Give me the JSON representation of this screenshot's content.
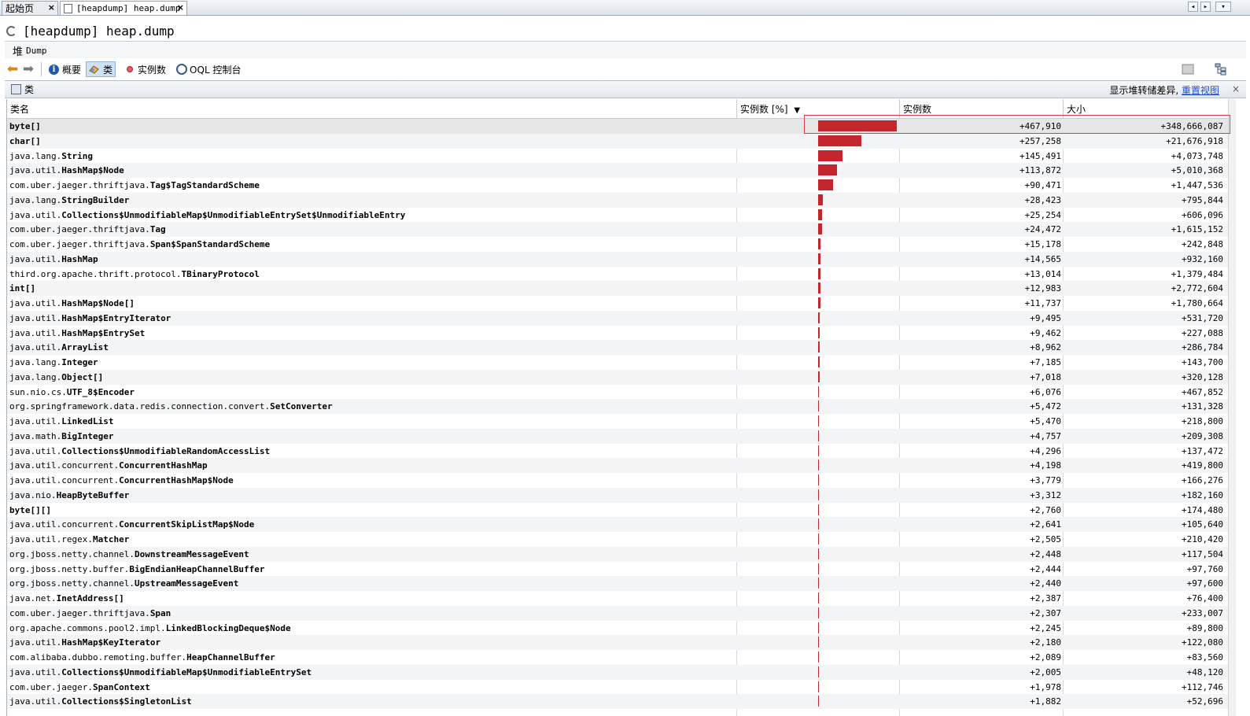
{
  "tabs": [
    {
      "label": "起始页",
      "close": "×"
    },
    {
      "label": "[heapdump] heap.dump",
      "close": "×"
    }
  ],
  "title": "[heapdump] heap.dump",
  "heap_bar": {
    "zh": "堆",
    "label": "Dump"
  },
  "toolbar": {
    "overview": "概要",
    "classes": "类",
    "instances": "实例数",
    "oql": "OQL 控制台"
  },
  "panel": {
    "title": "类",
    "diff_text": "显示堆转储差异,",
    "reset_link": "重置视图",
    "close": "×"
  },
  "columns": {
    "name": "类名",
    "percent": "实例数 [%]",
    "count": "实例数",
    "size": "大小"
  },
  "rows": [
    {
      "pkg": "",
      "cls": "byte[]",
      "count": "+467,910",
      "size": "+348,666,087",
      "pct": 100
    },
    {
      "pkg": "",
      "cls": "char[]",
      "count": "+257,258",
      "size": "+21,676,918",
      "pct": 55
    },
    {
      "pkg": "java.lang.",
      "cls": "String",
      "count": "+145,491",
      "size": "+4,073,748",
      "pct": 31
    },
    {
      "pkg": "java.util.",
      "cls": "HashMap$Node",
      "count": "+113,872",
      "size": "+5,010,368",
      "pct": 24
    },
    {
      "pkg": "com.uber.jaeger.thriftjava.",
      "cls": "Tag$TagStandardScheme",
      "count": "+90,471",
      "size": "+1,447,536",
      "pct": 19
    },
    {
      "pkg": "java.lang.",
      "cls": "StringBuilder",
      "count": "+28,423",
      "size": "+795,844",
      "pct": 6
    },
    {
      "pkg": "java.util.",
      "cls": "Collections$UnmodifiableMap$UnmodifiableEntrySet$UnmodifiableEntry",
      "count": "+25,254",
      "size": "+606,096",
      "pct": 5.4
    },
    {
      "pkg": "com.uber.jaeger.thriftjava.",
      "cls": "Tag",
      "count": "+24,472",
      "size": "+1,615,152",
      "pct": 5.2
    },
    {
      "pkg": "com.uber.jaeger.thriftjava.",
      "cls": "Span$SpanStandardScheme",
      "count": "+15,178",
      "size": "+242,848",
      "pct": 3.2
    },
    {
      "pkg": "java.util.",
      "cls": "HashMap",
      "count": "+14,565",
      "size": "+932,160",
      "pct": 3.1
    },
    {
      "pkg": "third.org.apache.thrift.protocol.",
      "cls": "TBinaryProtocol",
      "count": "+13,014",
      "size": "+1,379,484",
      "pct": 2.8
    },
    {
      "pkg": "",
      "cls": "int[]",
      "count": "+12,983",
      "size": "+2,772,604",
      "pct": 2.8
    },
    {
      "pkg": "java.util.",
      "cls": "HashMap$Node[]",
      "count": "+11,737",
      "size": "+1,780,664",
      "pct": 2.5
    },
    {
      "pkg": "java.util.",
      "cls": "HashMap$EntryIterator",
      "count": "+9,495",
      "size": "+531,720",
      "pct": 2.0
    },
    {
      "pkg": "java.util.",
      "cls": "HashMap$EntrySet",
      "count": "+9,462",
      "size": "+227,088",
      "pct": 2.0
    },
    {
      "pkg": "java.util.",
      "cls": "ArrayList",
      "count": "+8,962",
      "size": "+286,784",
      "pct": 1.9
    },
    {
      "pkg": "java.lang.",
      "cls": "Integer",
      "count": "+7,185",
      "size": "+143,700",
      "pct": 1.5
    },
    {
      "pkg": "java.lang.",
      "cls": "Object[]",
      "count": "+7,018",
      "size": "+320,128",
      "pct": 1.5
    },
    {
      "pkg": "sun.nio.cs.",
      "cls": "UTF_8$Encoder",
      "count": "+6,076",
      "size": "+467,852",
      "pct": 1.3
    },
    {
      "pkg": "org.springframework.data.redis.connection.convert.",
      "cls": "SetConverter",
      "count": "+5,472",
      "size": "+131,328",
      "pct": 1.2
    },
    {
      "pkg": "java.util.",
      "cls": "LinkedList",
      "count": "+5,470",
      "size": "+218,800",
      "pct": 1.2
    },
    {
      "pkg": "java.math.",
      "cls": "BigInteger",
      "count": "+4,757",
      "size": "+209,308",
      "pct": 1.0
    },
    {
      "pkg": "java.util.",
      "cls": "Collections$UnmodifiableRandomAccessList",
      "count": "+4,296",
      "size": "+137,472",
      "pct": 0.9
    },
    {
      "pkg": "java.util.concurrent.",
      "cls": "ConcurrentHashMap",
      "count": "+4,198",
      "size": "+419,800",
      "pct": 0.9
    },
    {
      "pkg": "java.util.concurrent.",
      "cls": "ConcurrentHashMap$Node",
      "count": "+3,779",
      "size": "+166,276",
      "pct": 0.8
    },
    {
      "pkg": "java.nio.",
      "cls": "HeapByteBuffer",
      "count": "+3,312",
      "size": "+182,160",
      "pct": 0.7
    },
    {
      "pkg": "",
      "cls": "byte[][]",
      "count": "+2,760",
      "size": "+174,480",
      "pct": 0.6
    },
    {
      "pkg": "java.util.concurrent.",
      "cls": "ConcurrentSkipListMap$Node",
      "count": "+2,641",
      "size": "+105,640",
      "pct": 0.6
    },
    {
      "pkg": "java.util.regex.",
      "cls": "Matcher",
      "count": "+2,505",
      "size": "+210,420",
      "pct": 0.5
    },
    {
      "pkg": "org.jboss.netty.channel.",
      "cls": "DownstreamMessageEvent",
      "count": "+2,448",
      "size": "+117,504",
      "pct": 0.5
    },
    {
      "pkg": "org.jboss.netty.buffer.",
      "cls": "BigEndianHeapChannelBuffer",
      "count": "+2,444",
      "size": "+97,760",
      "pct": 0.5
    },
    {
      "pkg": "org.jboss.netty.channel.",
      "cls": "UpstreamMessageEvent",
      "count": "+2,440",
      "size": "+97,600",
      "pct": 0.5
    },
    {
      "pkg": "java.net.",
      "cls": "InetAddress[]",
      "count": "+2,387",
      "size": "+76,400",
      "pct": 0.5
    },
    {
      "pkg": "com.uber.jaeger.thriftjava.",
      "cls": "Span",
      "count": "+2,307",
      "size": "+233,007",
      "pct": 0.5
    },
    {
      "pkg": "org.apache.commons.pool2.impl.",
      "cls": "LinkedBlockingDeque$Node",
      "count": "+2,245",
      "size": "+89,800",
      "pct": 0.5
    },
    {
      "pkg": "java.util.",
      "cls": "HashMap$KeyIterator",
      "count": "+2,180",
      "size": "+122,080",
      "pct": 0.5
    },
    {
      "pkg": "com.alibaba.dubbo.remoting.buffer.",
      "cls": "HeapChannelBuffer",
      "count": "+2,089",
      "size": "+83,560",
      "pct": 0.4
    },
    {
      "pkg": "java.util.",
      "cls": "Collections$UnmodifiableMap$UnmodifiableEntrySet",
      "count": "+2,005",
      "size": "+48,120",
      "pct": 0.4
    },
    {
      "pkg": "com.uber.jaeger.",
      "cls": "SpanContext",
      "count": "+1,978",
      "size": "+112,746",
      "pct": 0.4
    },
    {
      "pkg": "java.util.",
      "cls": "Collections$SingletonList",
      "count": "+1,882",
      "size": "+52,696",
      "pct": 0.4
    }
  ],
  "colors": {
    "bar": "#c4262e",
    "link": "#1f4fd8"
  }
}
